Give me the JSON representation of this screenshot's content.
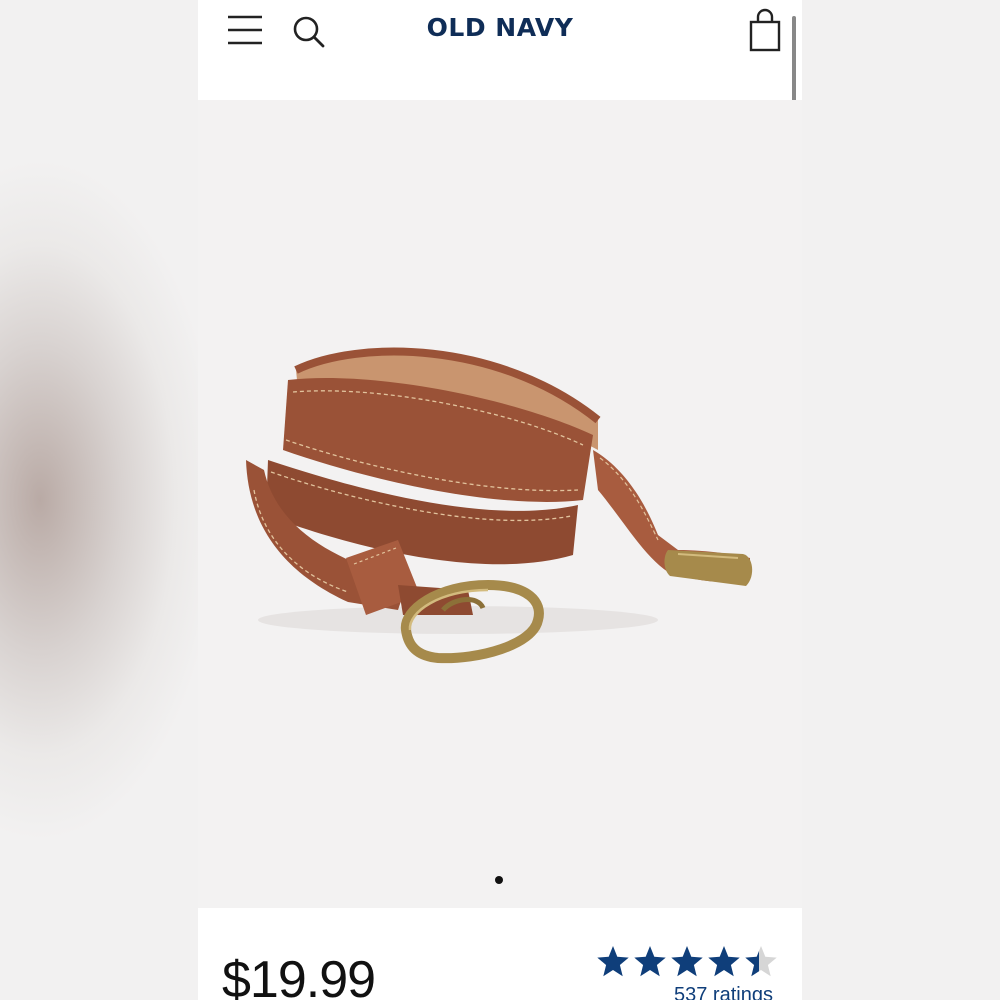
{
  "header": {
    "logo": "OLD NAVY",
    "menu_icon": "hamburger-menu-icon",
    "search_icon": "search-icon",
    "cart_icon": "shopping-bag-icon"
  },
  "gallery": {
    "image": "brown leather belt with brass buckle",
    "active_slide": 1,
    "total_slides": 1
  },
  "product": {
    "price": "$19.99",
    "rating": 4.5,
    "rating_max": 5,
    "ratings_count": "537 ratings"
  },
  "colors": {
    "brand_navy": "#0f2d57",
    "star": "#0f3e7a",
    "belt_leather": "#9a5237",
    "buckle_brass": "#a68a4b"
  }
}
